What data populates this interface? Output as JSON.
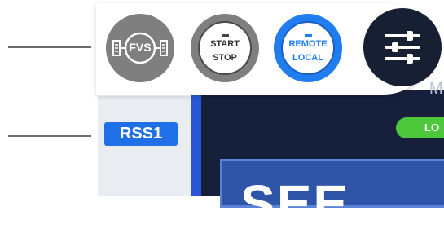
{
  "side_panel": {
    "tag_label": "RSS1"
  },
  "main": {
    "status_label": "LO",
    "header_letter": "M",
    "big_value": "SEE"
  },
  "toolbar": {
    "fvs_label": "FVS",
    "start_label": "START",
    "stop_label": "STOP",
    "remote_label": "REMOTE",
    "local_label": "LOCAL",
    "menu_icon": "sliders-icon"
  },
  "colors": {
    "accent": "#1f7df0",
    "tag": "#1f6fe6",
    "status": "#4cc83a",
    "dark": "#172033",
    "gray_button": "#7f7f7f"
  }
}
